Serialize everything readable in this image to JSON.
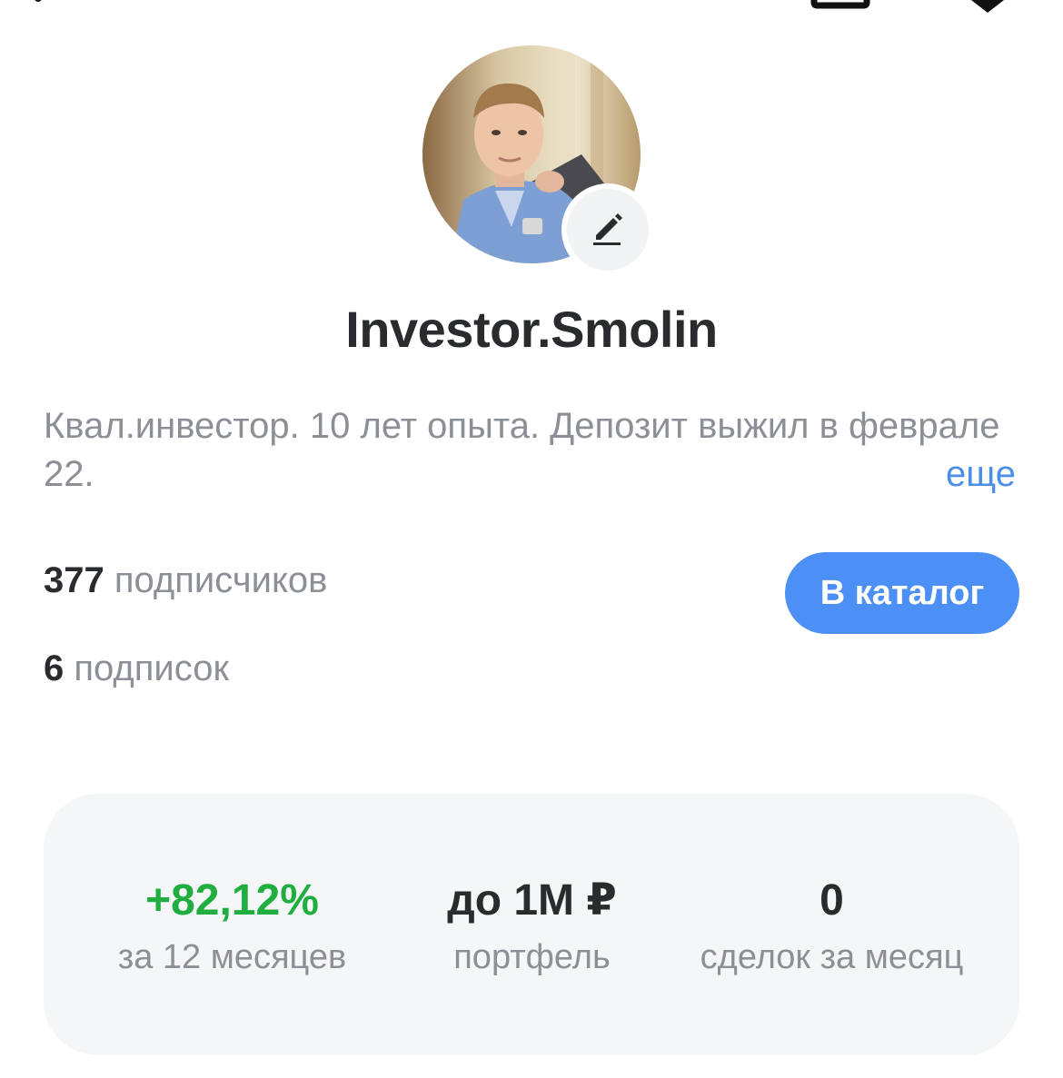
{
  "profile": {
    "username": "Investor.Smolin",
    "bio": "Квал.инвестор. 10 лет опыта. Депозит выжил в феврале 22.",
    "bio_more": "еще",
    "followers_count": "377",
    "followers_label": "подписчиков",
    "following_count": "6",
    "following_label": "подписок",
    "catalog_button": "В каталог"
  },
  "stats": [
    {
      "value": "+82,12%",
      "caption": "за 12 месяцев",
      "color": "#1fae3f"
    },
    {
      "value": "до 1M ₽",
      "caption": "портфель"
    },
    {
      "value": "0",
      "caption": "сделок за месяц"
    }
  ],
  "icons": {
    "back": "chevron-left-icon",
    "share": "share-icon",
    "menu": "menu-icon",
    "edit": "pencil-icon"
  },
  "colors": {
    "accent": "#4c8ff5",
    "link": "#4a8ee8",
    "positive": "#1fae3f"
  }
}
